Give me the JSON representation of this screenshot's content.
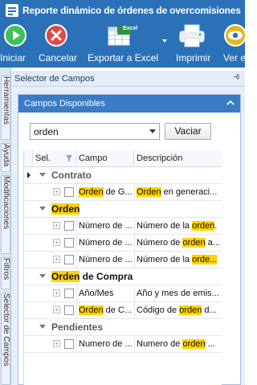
{
  "window": {
    "title": "Reporte dinámico de órdenes de overcomisiones"
  },
  "ribbon": {
    "buttons": [
      {
        "label": "Iniciar",
        "icon": "play-icon",
        "color": "#3ec05a"
      },
      {
        "label": "Cancelar",
        "icon": "cancel-icon",
        "color": "#e04848"
      },
      {
        "label": "Exportar a Excel",
        "icon": "excel-icon",
        "badge": "Excel"
      },
      {
        "label": "Imprimir",
        "icon": "printer-icon"
      },
      {
        "label": "Ver e",
        "icon": "eye-icon",
        "color": "#e5b81f"
      }
    ]
  },
  "left_tabs": [
    "Herramientas",
    "Ayuda",
    "Modificaciones",
    "Filtros",
    "Selector de Campos"
  ],
  "pane": {
    "title": "Selector de Campos"
  },
  "group": {
    "title": "Campos Disponibles"
  },
  "search": {
    "value": "orden",
    "clear_label": "Vaciar"
  },
  "grid": {
    "columns": [
      "Sel.",
      "Campo",
      "Descripción"
    ],
    "highlight_color": "#ffd200",
    "rows": [
      {
        "type": "group",
        "caption": "Contrato"
      },
      {
        "type": "item",
        "campo": [
          {
            "t": "Orden",
            "h": true
          },
          {
            "t": " de G..."
          }
        ],
        "descripcion": [
          {
            "t": "Orden",
            "h": true
          },
          {
            "t": " en generaci..."
          }
        ]
      },
      {
        "type": "group",
        "caption": "Orden",
        "highlight": true
      },
      {
        "type": "item",
        "campo": [
          {
            "t": "Número de ..."
          }
        ],
        "descripcion": [
          {
            "t": "Número de la "
          },
          {
            "t": "orden",
            "h": true
          },
          {
            "t": "."
          }
        ]
      },
      {
        "type": "item",
        "campo": [
          {
            "t": "Número de ..."
          }
        ],
        "descripcion": [
          {
            "t": "Número de "
          },
          {
            "t": "orden",
            "h": true
          },
          {
            "t": " a..."
          }
        ]
      },
      {
        "type": "item",
        "campo": [
          {
            "t": "Número de ..."
          }
        ],
        "descripcion": [
          {
            "t": "Número de la "
          },
          {
            "t": "orde...",
            "h": true
          }
        ]
      },
      {
        "type": "group",
        "caption_parts": [
          {
            "t": "Orden",
            "h": true
          },
          {
            "t": " de Compra"
          }
        ]
      },
      {
        "type": "item",
        "campo": [
          {
            "t": "Año/Mes"
          }
        ],
        "descripcion": [
          {
            "t": "Año y mes de emis..."
          }
        ]
      },
      {
        "type": "item",
        "campo": [
          {
            "t": "Orden",
            "h": true
          },
          {
            "t": " de C..."
          }
        ],
        "descripcion": [
          {
            "t": "Código de "
          },
          {
            "t": "orden",
            "h": true
          },
          {
            "t": " d..."
          }
        ]
      },
      {
        "type": "group",
        "caption": "Pendientes"
      },
      {
        "type": "item",
        "campo": [
          {
            "t": "Numero de ..."
          }
        ],
        "descripcion": [
          {
            "t": "Numero de "
          },
          {
            "t": "orden",
            "h": true
          },
          {
            "t": " ..."
          }
        ]
      }
    ]
  }
}
